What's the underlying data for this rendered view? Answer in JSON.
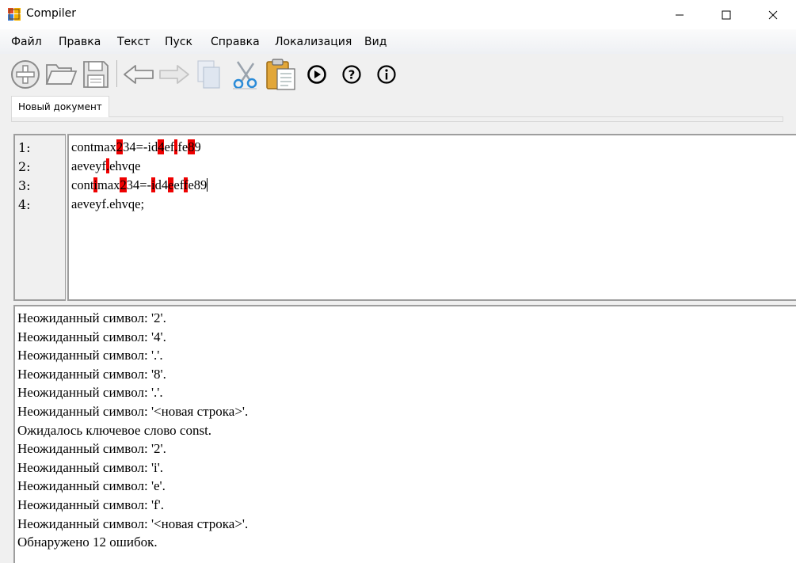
{
  "window": {
    "title": "Compiler"
  },
  "menu": [
    "Файл",
    "Правка",
    "Текст",
    "Пуск",
    "Справка",
    "Локализация",
    "Вид"
  ],
  "toolbar": {
    "buttons": [
      "new-file",
      "open-file",
      "save-file",
      "undo",
      "redo",
      "copy",
      "cut",
      "paste",
      "run",
      "help",
      "about"
    ]
  },
  "tabs": [
    {
      "label": "Новый документ"
    }
  ],
  "editor": {
    "line_numbers": [
      "1:",
      "2:",
      "3:",
      "4:"
    ],
    "lines": [
      [
        {
          "t": "contmax",
          "e": false
        },
        {
          "t": "2",
          "e": true
        },
        {
          "t": "34=-id",
          "e": false
        },
        {
          "t": "4",
          "e": true
        },
        {
          "t": "ef",
          "e": false
        },
        {
          "t": ".",
          "e": true
        },
        {
          "t": "fe",
          "e": false
        },
        {
          "t": "8",
          "e": true
        },
        {
          "t": "9",
          "e": false
        }
      ],
      [
        {
          "t": "aeveyf",
          "e": false
        },
        {
          "t": ".",
          "e": true
        },
        {
          "t": "ehvqe",
          "e": false
        }
      ],
      [
        {
          "t": "cont",
          "e": false
        },
        {
          "t": "i",
          "e": true
        },
        {
          "t": "max",
          "e": false
        },
        {
          "t": "2",
          "e": true
        },
        {
          "t": "34=-",
          "e": false
        },
        {
          "t": "i",
          "e": true
        },
        {
          "t": "d4",
          "e": false
        },
        {
          "t": "e",
          "e": true
        },
        {
          "t": "ef",
          "e": false
        },
        {
          "t": "f",
          "e": true
        },
        {
          "t": "e89",
          "e": false
        }
      ],
      [
        {
          "t": "aeveyf.ehvqe;",
          "e": false
        }
      ]
    ]
  },
  "output": {
    "messages": [
      "Неожиданный символ: '2'.",
      "Неожиданный символ: '4'.",
      "Неожиданный символ: '.'.",
      "Неожиданный символ: '8'.",
      "Неожиданный символ: '.'.",
      "Неожиданный символ: '<новая строка>'.",
      "Ожидалось ключевое слово const.",
      "Неожиданный символ: '2'.",
      "Неожиданный символ: 'i'.",
      "Неожиданный символ: 'e'.",
      "Неожиданный символ: 'f'.",
      "Неожиданный символ: '<новая строка>'.",
      "Обнаружено 12 ошибок."
    ]
  },
  "colors": {
    "error_highlight": "#ee0000",
    "menu_bg": "#f5f6f8",
    "window_bg": "#f0f0f0"
  }
}
